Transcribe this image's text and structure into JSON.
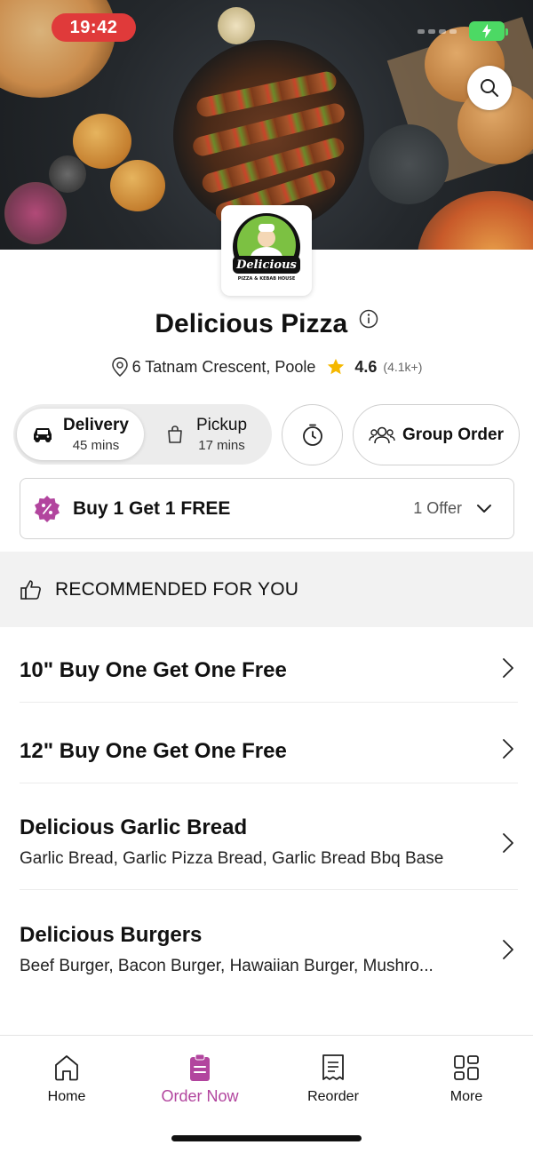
{
  "status_bar": {
    "time": "19:42"
  },
  "restaurant": {
    "name": "Delicious Pizza",
    "address": "6 Tatnam Crescent, Poole",
    "rating": "4.6",
    "rating_count": "(4.1k+)",
    "logo_text": "Delicious",
    "logo_subtext": "PIZZA & KEBAB HOUSE"
  },
  "order_modes": {
    "delivery": {
      "label": "Delivery",
      "time": "45 mins",
      "selected": true
    },
    "pickup": {
      "label": "Pickup",
      "time": "17 mins",
      "selected": false
    }
  },
  "group_order_label": "Group Order",
  "offer": {
    "title": "Buy 1 Get 1 FREE",
    "count": "1 Offer"
  },
  "recommended": {
    "title": "RECOMMENDED FOR YOU",
    "items": [
      {
        "title": "10\" Buy One Get One Free",
        "subtitle": ""
      },
      {
        "title": "12\" Buy One Get One Free",
        "subtitle": ""
      },
      {
        "title": "Delicious Garlic Bread",
        "subtitle": "Garlic Bread, Garlic Pizza Bread, Garlic Bread Bbq Base"
      },
      {
        "title": "Delicious Burgers",
        "subtitle": "Beef Burger, Bacon Burger, Hawaiian Burger, Mushro..."
      }
    ]
  },
  "tabbar": {
    "home": "Home",
    "order_now": "Order Now",
    "reorder": "Reorder",
    "more": "More",
    "active": "order_now"
  },
  "colors": {
    "accent": "#b2459e",
    "status_pill": "#e03a3a",
    "star": "#f5b800",
    "battery": "#4cd964"
  },
  "icons": {
    "search": "search-icon",
    "info": "info-icon",
    "location": "location-pin-icon",
    "star": "star-icon",
    "car": "car-icon",
    "bag": "shopping-bag-icon",
    "timer": "timer-icon",
    "group": "group-icon",
    "offer": "discount-badge-icon",
    "chevron_down": "chevron-down-icon",
    "chevron_right": "chevron-right-icon",
    "thumbs_up": "thumbs-up-icon",
    "home": "home-icon",
    "order": "order-clipboard-icon",
    "reorder": "receipt-icon",
    "more": "grid-icon"
  }
}
